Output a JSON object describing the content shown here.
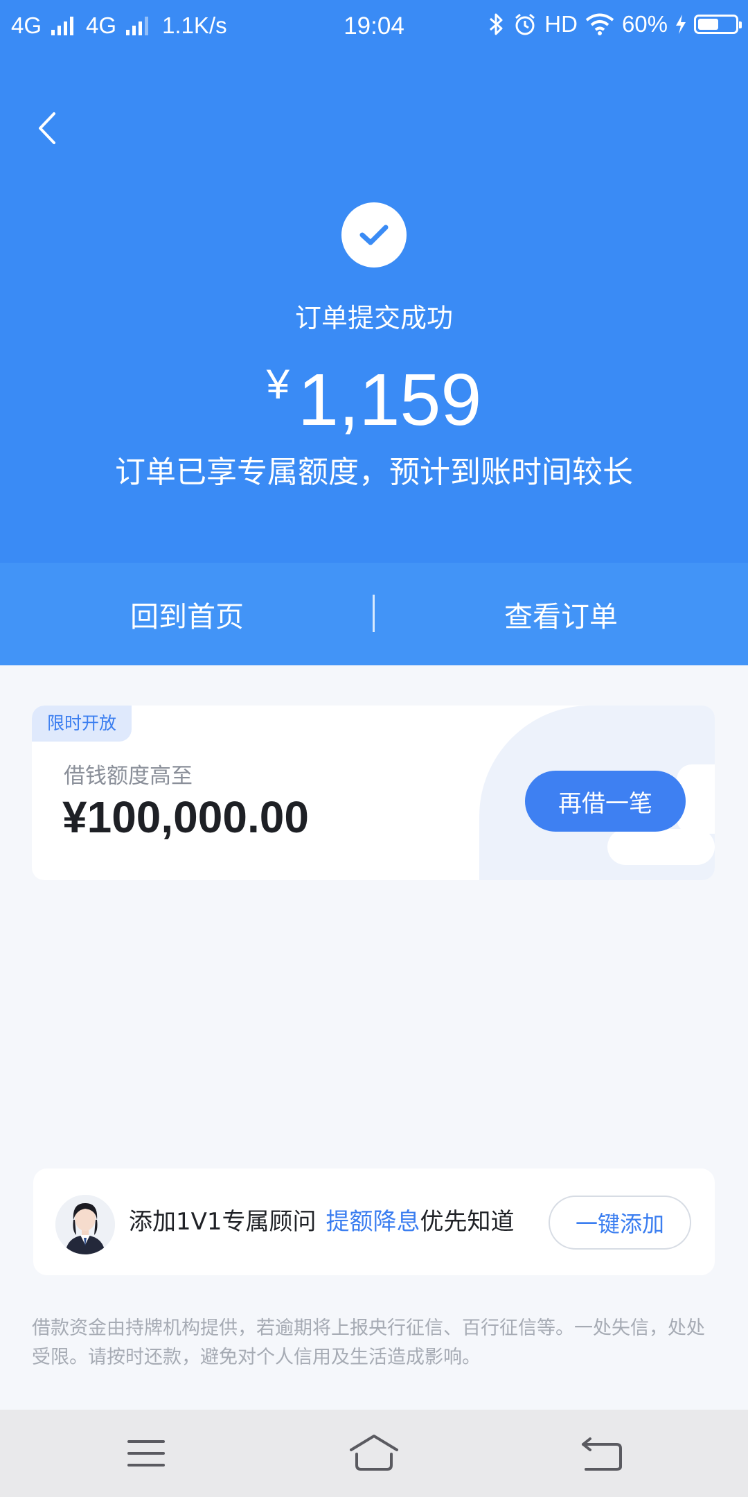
{
  "status_bar": {
    "network1": "4G",
    "network2": "4G",
    "speed": "1.1K/s",
    "time": "19:04",
    "hd": "HD",
    "battery_percent": "60%",
    "battery_level": 0.6,
    "icons": [
      "signal-icon",
      "bluetooth-icon",
      "alarm-icon",
      "wifi-icon",
      "charging-icon",
      "battery-icon"
    ]
  },
  "header": {
    "title": "订单提交成功",
    "currency": "¥",
    "amount": "1,159",
    "subtitle": "订单已享专属额度，预计到账时间较长"
  },
  "actions": {
    "home_label": "回到首页",
    "order_label": "查看订单"
  },
  "promo": {
    "tag": "限时开放",
    "label": "借钱额度高至",
    "amount": "¥100,000.00",
    "button_label": "再借一笔"
  },
  "advisor": {
    "text_prefix": "添加1V1专属顾问",
    "highlight": "提额降息",
    "text_suffix": "优先知道",
    "button_label": "一键添加"
  },
  "disclaimer": "借款资金由持牌机构提供，若逾期将上报央行征信、百行征信等。一处失信，处处受限。请按时还款，避免对个人信用及生活造成影响。",
  "colors": {
    "primary_blue": "#3a8bf5",
    "action_bar_blue": "#4294f7",
    "button_blue": "#3e80f2",
    "highlight_blue": "#3b7ef0",
    "background": "#f5f7fb"
  }
}
